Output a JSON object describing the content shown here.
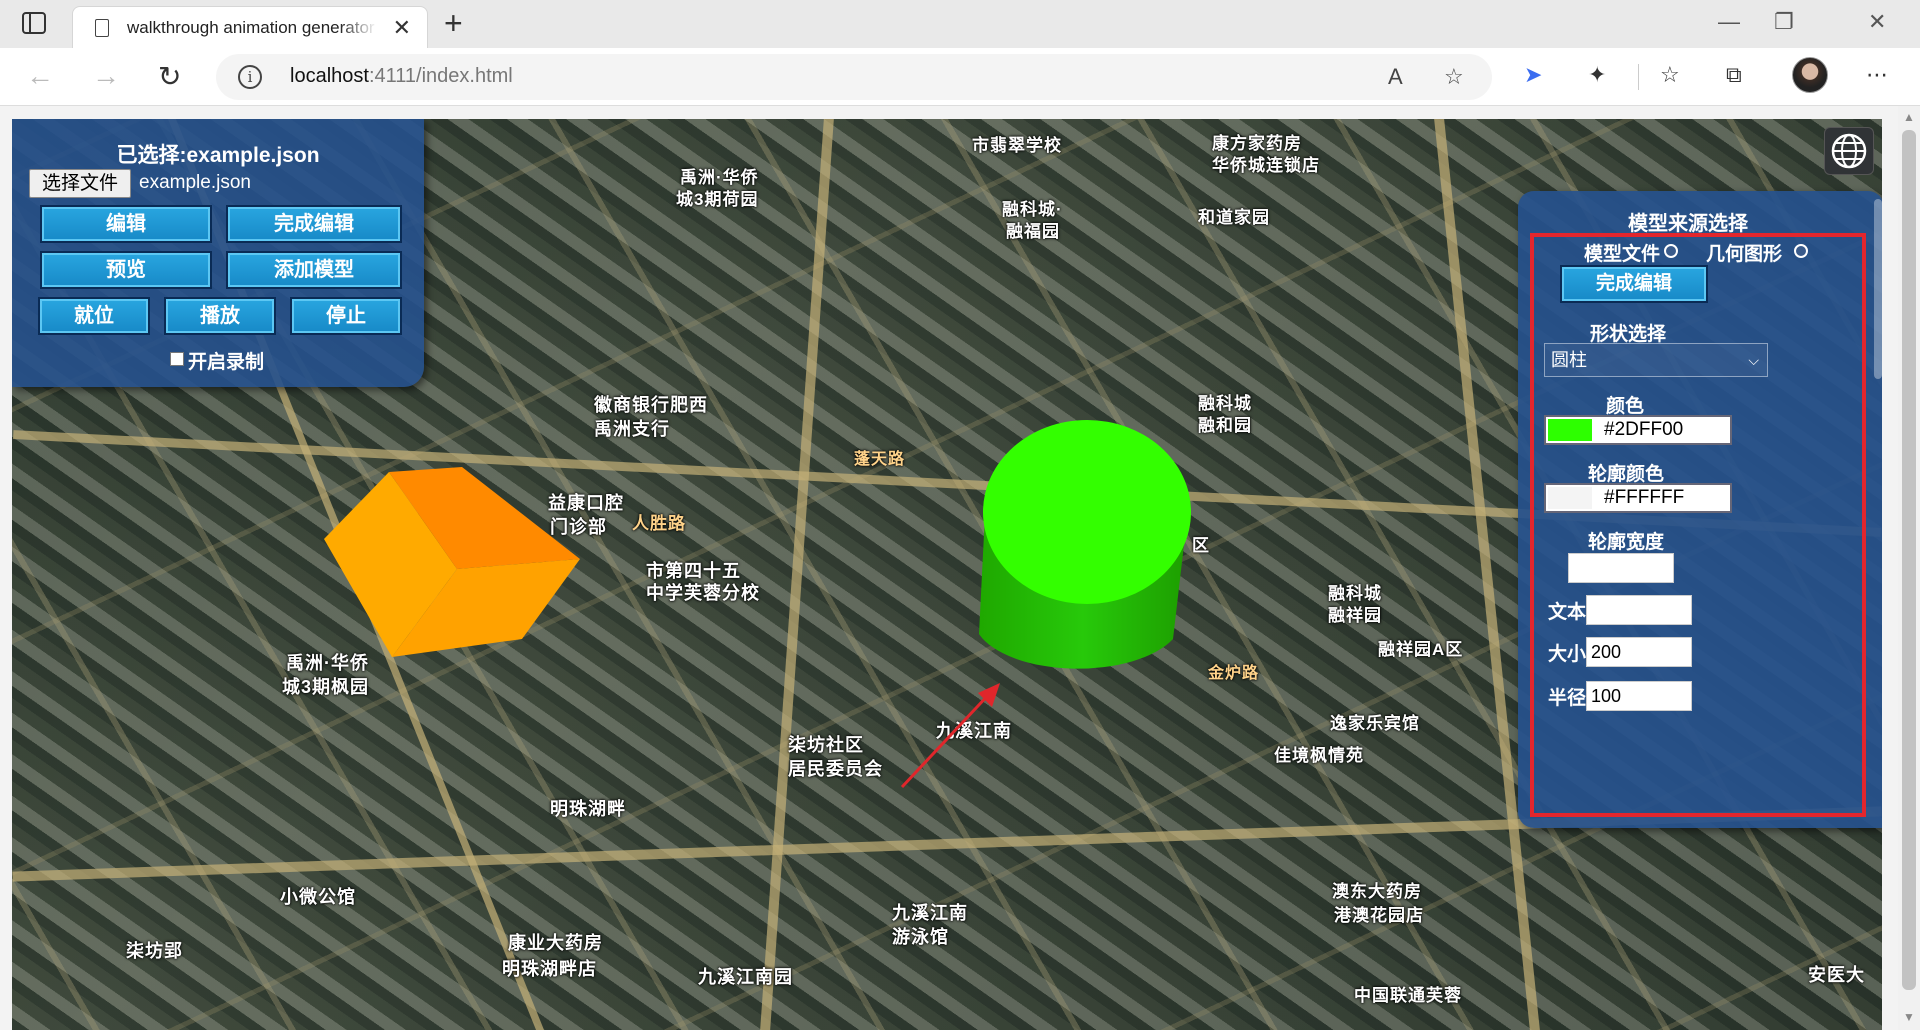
{
  "browser": {
    "tab_title": "walkthrough animation generator",
    "tab_close": "✕",
    "new_tab": "+",
    "window_controls": [
      "—",
      "❐",
      "✕"
    ],
    "url_host": "localhost",
    "url_rest": ":4111/index.html",
    "icons": [
      "tab-actions-icon",
      "page-icon",
      "back-icon",
      "forward-icon",
      "reload-icon",
      "site-info-icon",
      "read-aloud-icon",
      "add-favorite-icon",
      "extension-icon",
      "puzzle-icon",
      "favorites-icon",
      "collections-icon",
      "profile-avatar",
      "more-icon"
    ]
  },
  "left_panel": {
    "title": "已选择:example.json",
    "file_button": "选择文件",
    "file_name": "example.json",
    "buttons": {
      "edit": "编辑",
      "finish_edit": "完成编辑",
      "preview": "预览",
      "add_model": "添加模型",
      "ready": "就位",
      "play": "播放",
      "stop": "停止"
    },
    "record_label": "开启录制",
    "record_checked": false
  },
  "right_panel": {
    "title": "模型来源选择",
    "radio_model_file": "模型文件",
    "radio_geometry": "几何图形",
    "finish_button": "完成编辑",
    "shape_label": "形状选择",
    "shape_value": "圆柱",
    "color_label": "颜色",
    "color_value": "#2DFF00",
    "outline_color_label": "轮廓颜色",
    "outline_color_value": "#FFFFFF",
    "outline_width_label": "轮廓宽度",
    "outline_width_value": "",
    "text_label": "文本",
    "text_value": "",
    "size_label": "大小",
    "size_value": "200",
    "radius_label": "半径",
    "radius_value": "100"
  },
  "map_labels": [
    "市翡翠学校",
    "康方家药房",
    "华侨城连锁店",
    "禹洲·华侨",
    "城3期荷园",
    "融科城·",
    "融福园",
    "和道家园",
    "徽商银行肥西",
    "禹洲支行",
    "融科城",
    "融和园",
    "蓬天路",
    "益康口腔",
    "门诊部",
    "人胜路",
    "市第四十五",
    "中学芙蓉分校",
    "区",
    "融科城",
    "融祥园",
    "融祥园A区",
    "金炉路",
    "禹洲·华侨",
    "城3期枫园",
    "柒坊社区",
    "居民委员会",
    "九溪江南",
    "逸家乐宾馆",
    "佳境枫情苑",
    "明珠湖畔",
    "小微公馆",
    "九溪江南",
    "游泳馆",
    "澳东大药房",
    "港澳花园店",
    "康业大药房",
    "明珠湖畔店",
    "九溪江南园",
    "柒坊郢",
    "中国联通芙蓉",
    "安医大"
  ],
  "colors": {
    "panel_bg": "#26518d",
    "button_blue": "#1d96d4",
    "highlight_red": "#e3262d",
    "cylinder": "#2DFF00",
    "cube": "#ffa500"
  }
}
